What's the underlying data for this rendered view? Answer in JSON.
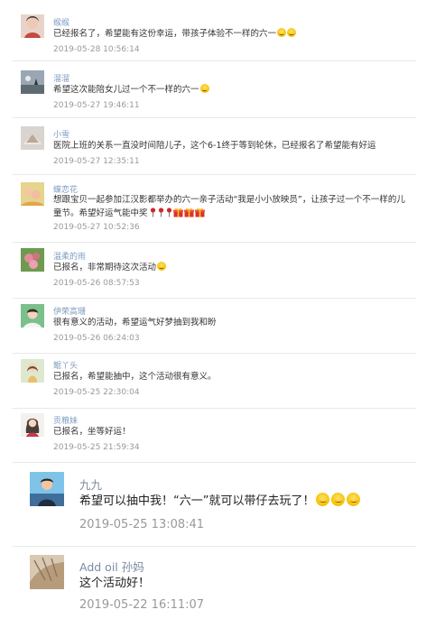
{
  "comments": [
    {
      "user": "缑缑",
      "text": "已经报名了，希望能有这份幸运，带孩子体验不一样的六一",
      "emoji": 2,
      "time": "2019-05-28 10:56:14"
    },
    {
      "user": "溜溜",
      "text": "希望这次能陪女儿过一个不一样的六一",
      "emoji": 1,
      "time": "2019-05-27 19:46:11"
    },
    {
      "user": "小雪",
      "text": "医院上班的关系一直没时间陪儿子，这个6-1终于等到轮休，已经报名了希望能有好运",
      "emoji": 0,
      "time": "2019-05-27 12:35:11"
    },
    {
      "user": "蝶恋花",
      "text": "想跟宝贝一起参加江汉影都举办的六一亲子活动“我是小小放映员”，让孩子过一个不一样的儿童节。希望好运气能中奖",
      "emoji": 0,
      "pins": 3,
      "gifts": 3,
      "time": "2019-05-27 10:52:36"
    },
    {
      "user": "温柔的雨",
      "text": "已报名，非常期待这次活动",
      "emoji": 1,
      "time": "2019-05-26 08:57:53"
    },
    {
      "user": "伊荣高珊",
      "text": "很有意义的活动，希望运气好梦抽到我和盼",
      "emoji": 0,
      "time": "2019-05-26 06:24:03"
    },
    {
      "user": "鲲丫头",
      "text": "已报名，希望能抽中，这个活动很有意义。",
      "emoji": 0,
      "time": "2019-05-25 22:30:04"
    },
    {
      "user": "贡粮妹",
      "text": "已报名，坐等好运！",
      "emoji": 0,
      "time": "2019-05-25 21:59:34"
    },
    {
      "user": "九九",
      "text": "希望可以抽中我！“六一”就可以带仔去玩了！",
      "emoji": 3,
      "time": "2019-05-25 13:08:41"
    },
    {
      "user": "Add oil 孙妈",
      "text": "这个活动好！",
      "emoji": 0,
      "time": "2019-05-22 16:11:07"
    }
  ],
  "colors": {
    "name": "#7d9cc0",
    "time": "#999999",
    "divider": "#e9e9e9"
  }
}
